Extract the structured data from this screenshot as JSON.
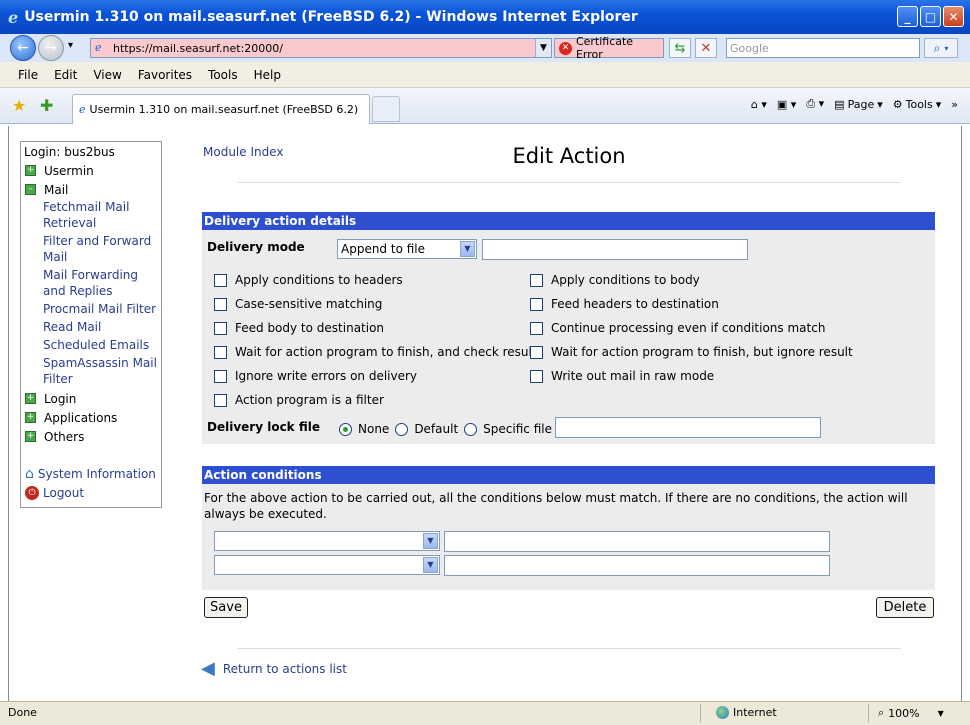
{
  "window": {
    "title": "Usermin 1.310 on mail.seasurf.net (FreeBSD 6.2) - Windows Internet Explorer",
    "minimize": "_",
    "maximize": "□",
    "close": "✕"
  },
  "addressbar": {
    "url": "https://mail.seasurf.net:20000/",
    "cert_error": "Certificate Error",
    "search_placeholder": "Google"
  },
  "menu": [
    "File",
    "Edit",
    "View",
    "Favorites",
    "Tools",
    "Help"
  ],
  "tab": {
    "title": "Usermin 1.310 on mail.seasurf.net (FreeBSD 6.2)"
  },
  "toolbar": {
    "page": "Page",
    "tools": "Tools"
  },
  "sidebar": {
    "login": "Login: bus2bus",
    "usermin": "Usermin",
    "mail": "Mail",
    "mail_items": [
      "Fetchmail Mail Retrieval",
      "Filter and Forward Mail",
      "Mail Forwarding and Replies",
      "Procmail Mail Filter",
      "Read Mail",
      "Scheduled Emails",
      "SpamAssassin Mail Filter"
    ],
    "login_cat": "Login",
    "applications": "Applications",
    "others": "Others",
    "system_information": "System Information",
    "logout": "Logout"
  },
  "main": {
    "module_index": "Module Index",
    "title": "Edit Action",
    "delivery_section": "Delivery action details",
    "delivery_mode_label": "Delivery mode",
    "delivery_mode_value": "Append to file",
    "checkboxes_left": [
      "Apply conditions to headers",
      "Case-sensitive matching",
      "Feed body to destination",
      "Wait for action program to finish, and check result",
      "Ignore write errors on delivery",
      "Action program is a filter"
    ],
    "checkboxes_right": [
      "Apply conditions to body",
      "Feed headers to destination",
      "Continue processing even if conditions match",
      "Wait for action program to finish, but ignore result",
      "Write out mail in raw mode"
    ],
    "lock_label": "Delivery lock file",
    "lock_options": [
      "None",
      "Default",
      "Specific file"
    ],
    "conditions_section": "Action conditions",
    "conditions_text": "For the above action to be carried out, all the conditions below must match. If there are no conditions, the action will always be executed.",
    "save": "Save",
    "delete": "Delete",
    "return_link": "Return to actions list"
  },
  "status": {
    "done": "Done",
    "zone": "Internet",
    "zoom": "100%"
  }
}
